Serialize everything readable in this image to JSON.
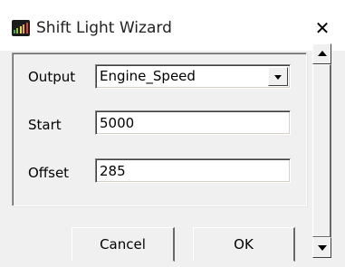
{
  "window": {
    "title": "Shift Light Wizard",
    "app_icon": "shift-light-bars-icon",
    "close_glyph": "✕"
  },
  "form": {
    "output": {
      "label": "Output",
      "value": "Engine_Speed"
    },
    "start": {
      "label": "Start",
      "value": "5000"
    },
    "offset": {
      "label": "Offset",
      "value": "285"
    }
  },
  "buttons": {
    "cancel": "Cancel",
    "ok": "OK"
  },
  "scrollbar": {
    "up_icon": "scroll-up-arrow-icon",
    "down_icon": "scroll-down-arrow-icon"
  },
  "colors": {
    "window_bg": "#f0f0f0",
    "titlebar_bg": "#ffffff",
    "icon_bars": [
      "#3bb54a",
      "#8bc53f",
      "#f7e11b",
      "#f5a623",
      "#e8402a"
    ]
  }
}
